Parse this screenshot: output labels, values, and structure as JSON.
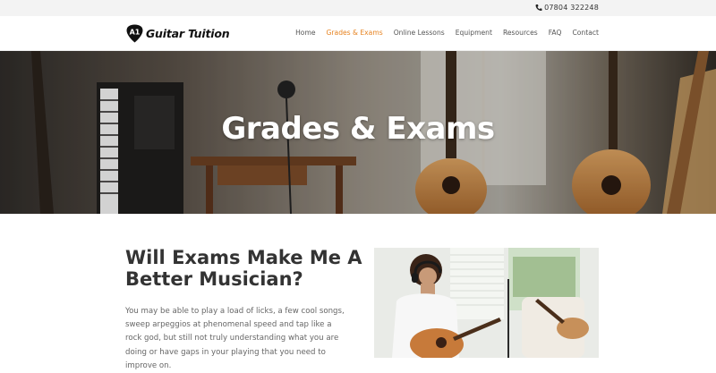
{
  "topbar": {
    "phone": "07804 322248",
    "phone_icon": "phone-icon"
  },
  "header": {
    "logo_mark": "A1",
    "logo_text": "Guitar Tuition",
    "nav": [
      {
        "label": "Home",
        "active": false
      },
      {
        "label": "Grades & Exams",
        "active": true
      },
      {
        "label": "Online Lessons",
        "active": false
      },
      {
        "label": "Equipment",
        "active": false
      },
      {
        "label": "Resources",
        "active": false
      },
      {
        "label": "FAQ",
        "active": false
      },
      {
        "label": "Contact",
        "active": false
      }
    ]
  },
  "hero": {
    "title": "Grades & Exams"
  },
  "main": {
    "heading": "Will Exams Make Me A Better Musician?",
    "paragraph": "You may be able to play a load of licks, a few cool songs, sweep arpeggios at phenomenal speed and tap like a rock god, but still not truly understanding what you are doing or have gaps in your playing that you need to improve on."
  },
  "colors": {
    "accent": "#e6821f",
    "topbar_bg": "#f3f3f3",
    "text_dark": "#333333",
    "text_body": "#666666"
  }
}
